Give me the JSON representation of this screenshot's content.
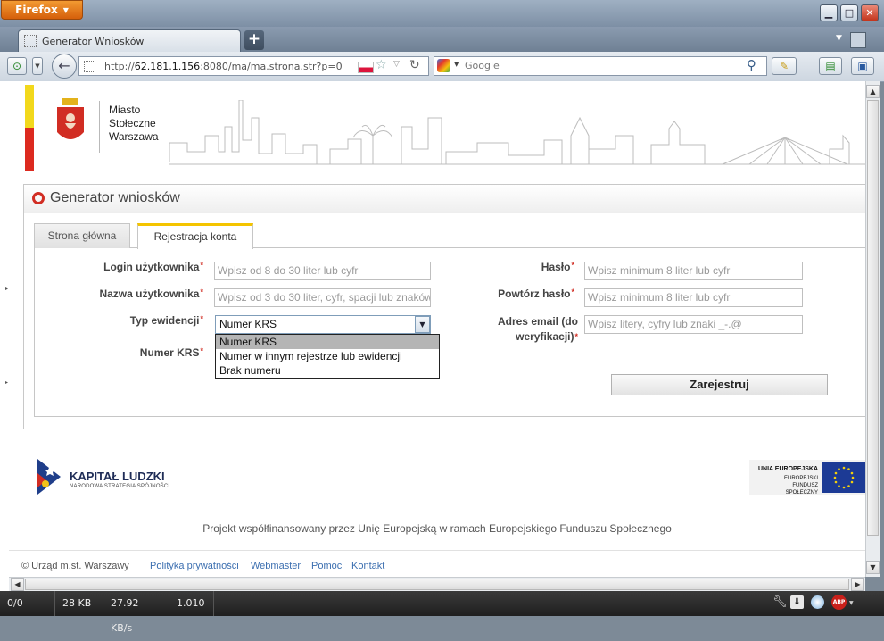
{
  "browser": {
    "app_button": "Firefox",
    "tab_title": "Generator Wniosków",
    "url_prefix": "http://",
    "url_host": "62.181.1.156",
    "url_rest": ":8080/ma/ma.strona.str?p=0",
    "search_placeholder": "Google"
  },
  "header": {
    "brand_line1": "Miasto",
    "brand_line2": "Stołeczne",
    "brand_line3": "Warszawa"
  },
  "panel": {
    "title": "Generator wniosków",
    "tabs": [
      {
        "label": "Strona główna"
      },
      {
        "label": "Rejestracja konta"
      }
    ]
  },
  "form": {
    "login_label": "Login użytkownika",
    "login_placeholder": "Wpisz od 8 do 30 liter lub cyfr",
    "username_label": "Nazwa użytkownika",
    "username_placeholder": "Wpisz od 3 do 30 liter, cyfr, spacji lub znaków",
    "evidence_label": "Typ ewidencji",
    "evidence_selected": "Numer KRS",
    "evidence_options": [
      "Numer KRS",
      "Numer w innym rejestrze lub ewidencji",
      "Brak numeru"
    ],
    "krs_label": "Numer KRS",
    "password_label": "Hasło",
    "password_placeholder": "Wpisz minimum 8 liter lub cyfr",
    "password2_label": "Powtórz hasło",
    "password2_placeholder": "Wpisz minimum 8 liter lub cyfr",
    "email_label_line1": "Adres email (do",
    "email_label_line2": "weryfikacji)",
    "email_placeholder": "Wpisz litery, cyfry lub znaki _-.@",
    "required_mark": "*",
    "submit_label": "Zarejestruj"
  },
  "footer": {
    "kl_title": "KAPITAŁ LUDZKI",
    "kl_subtitle": "NARODOWA STRATEGIA SPÓJNOŚCI",
    "ue_line1": "UNIA EUROPEJSKA",
    "ue_line2": "EUROPEJSKI",
    "ue_line3": "FUNDUSZ SPOŁECZNY",
    "project_text": "Projekt współfinansowany przez Unię Europejską w ramach Europejskiego Funduszu Społecznego",
    "copyright": "© Urząd m.st. Warszawy",
    "links": [
      "Polityka prywatności",
      "Webmaster",
      "Pomoc",
      "Kontakt"
    ]
  },
  "statusbar": {
    "cells": [
      "0/0",
      "28 KB",
      "27.92 KB/s",
      "1.010"
    ]
  },
  "icons": [
    "firefox-menu-icon",
    "minimize-icon",
    "maximize-icon",
    "close-icon",
    "new-tab-icon",
    "tab-list-icon",
    "back-icon",
    "reload-icon",
    "bookmark-star-icon",
    "google-icon",
    "search-icon",
    "addon-icon",
    "adblock-icon",
    "wrench-icon",
    "download-icon"
  ],
  "colors": {
    "accent_red": "#d12d23",
    "accent_yellow": "#f2d81c",
    "link_blue": "#3c6fb0"
  }
}
